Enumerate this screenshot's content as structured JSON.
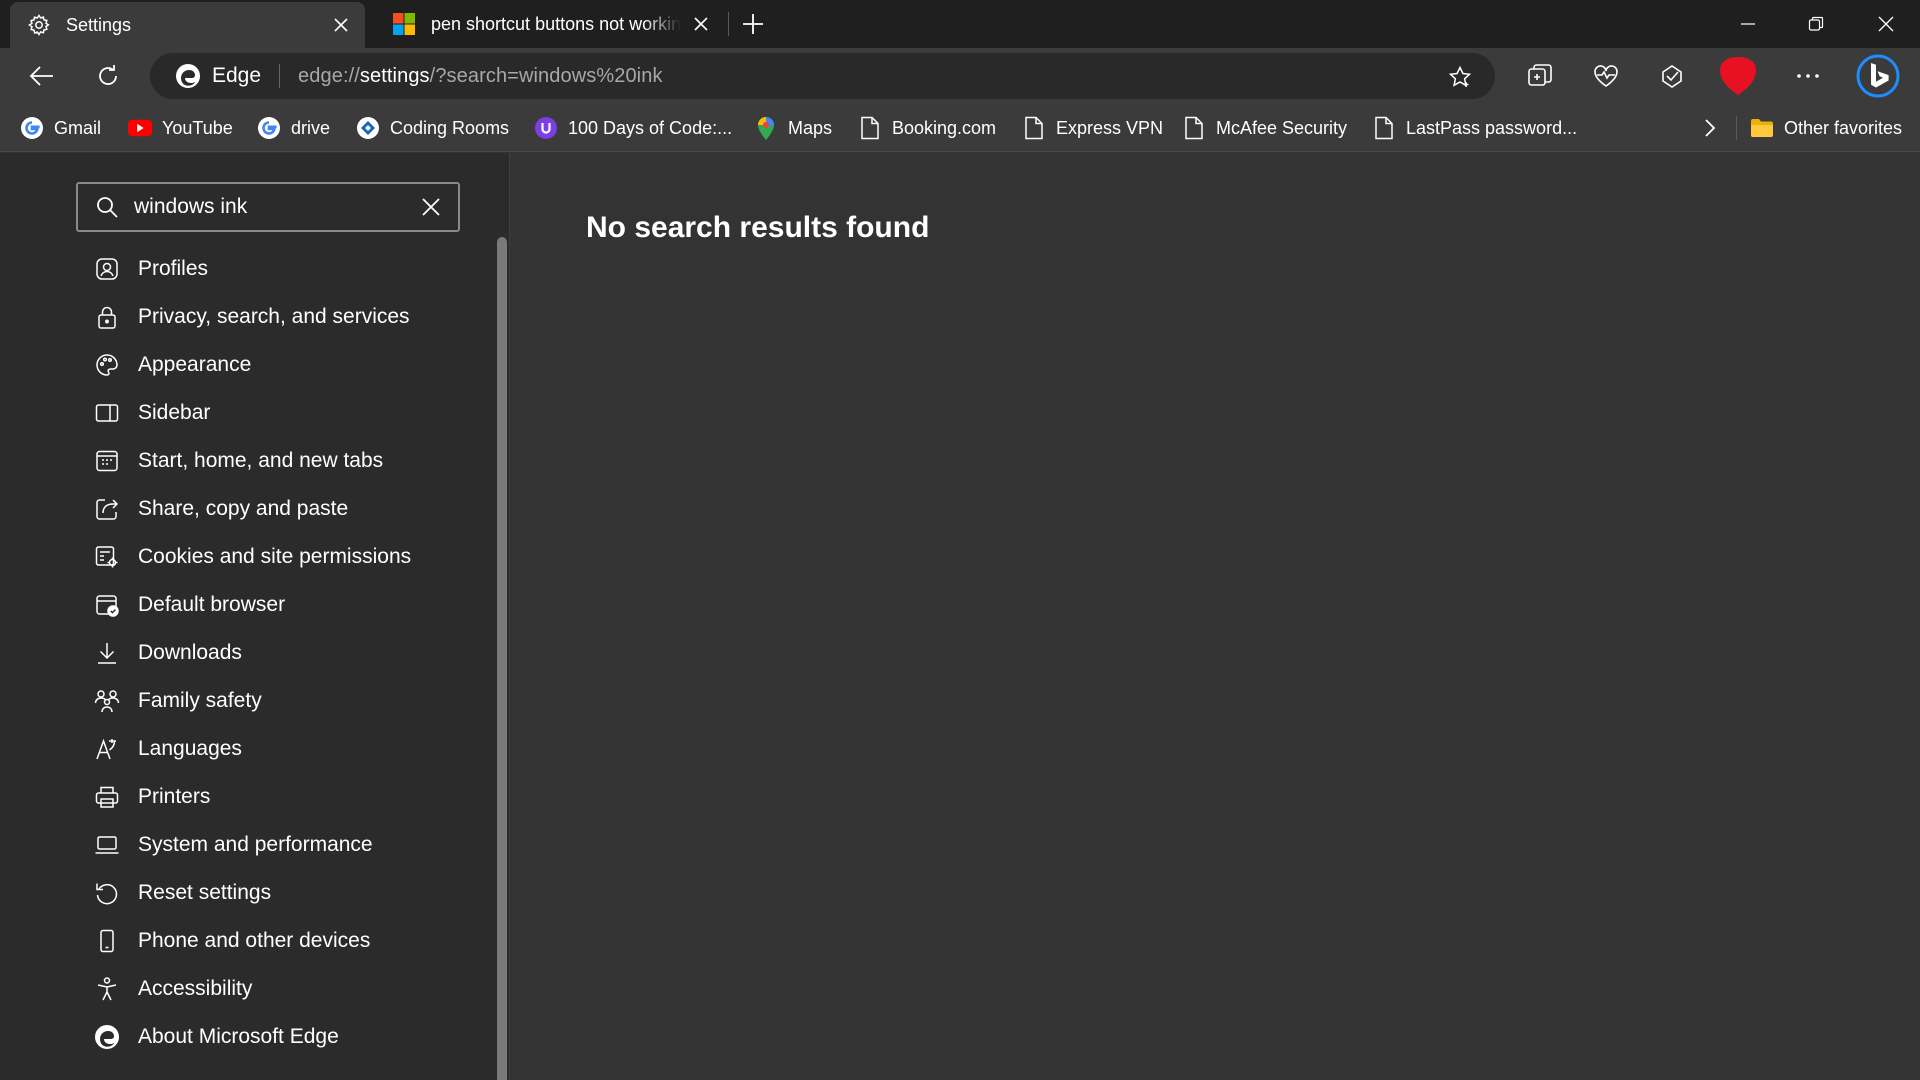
{
  "tabs": [
    {
      "title": "Settings",
      "icon": "gear-icon",
      "active": true
    },
    {
      "title": "pen shortcut buttons not working",
      "icon": "microsoft-logo-icon",
      "active": false
    }
  ],
  "address_bar": {
    "site_label": "Edge",
    "url_prefix": "edge://",
    "url_host": "settings",
    "url_rest": "/?search=windows%20ink"
  },
  "favorites": [
    {
      "label": "Gmail",
      "icon": "google-icon"
    },
    {
      "label": "YouTube",
      "icon": "youtube-icon"
    },
    {
      "label": "drive",
      "icon": "google-icon"
    },
    {
      "label": "Coding Rooms",
      "icon": "coding-rooms-icon"
    },
    {
      "label": "100 Days of Code:...",
      "icon": "100-days-icon"
    },
    {
      "label": "Maps",
      "icon": "maps-pin-icon"
    },
    {
      "label": "Booking.com",
      "icon": "page-icon"
    },
    {
      "label": "Express VPN",
      "icon": "page-icon"
    },
    {
      "label": "McAfee Security",
      "icon": "page-icon"
    },
    {
      "label": "LastPass password...",
      "icon": "page-icon"
    }
  ],
  "other_favorites": "Other favorites",
  "settings": {
    "search_value": "windows ink",
    "nav_items": [
      {
        "label": "Profiles",
        "icon": "profiles-icon"
      },
      {
        "label": "Privacy, search, and services",
        "icon": "lock-icon"
      },
      {
        "label": "Appearance",
        "icon": "palette-icon"
      },
      {
        "label": "Sidebar",
        "icon": "sidebar-icon"
      },
      {
        "label": "Start, home, and new tabs",
        "icon": "home-tabs-icon"
      },
      {
        "label": "Share, copy and paste",
        "icon": "share-icon"
      },
      {
        "label": "Cookies and site permissions",
        "icon": "cookies-icon"
      },
      {
        "label": "Default browser",
        "icon": "default-browser-icon"
      },
      {
        "label": "Downloads",
        "icon": "download-icon"
      },
      {
        "label": "Family safety",
        "icon": "family-icon"
      },
      {
        "label": "Languages",
        "icon": "languages-icon"
      },
      {
        "label": "Printers",
        "icon": "printer-icon"
      },
      {
        "label": "System and performance",
        "icon": "laptop-icon"
      },
      {
        "label": "Reset settings",
        "icon": "reset-icon"
      },
      {
        "label": "Phone and other devices",
        "icon": "phone-icon"
      },
      {
        "label": "Accessibility",
        "icon": "accessibility-icon"
      },
      {
        "label": "About Microsoft Edge",
        "icon": "edge-logo-icon"
      }
    ]
  },
  "main": {
    "message": "No search results found"
  },
  "colors": {
    "tabstrip": "#1f1f1f",
    "toolbar": "#3b3b3b",
    "sidebar": "#2b2b2b",
    "content": "#333333",
    "profile_accent": "#e81123",
    "bing_accent": "#1f8cff"
  }
}
